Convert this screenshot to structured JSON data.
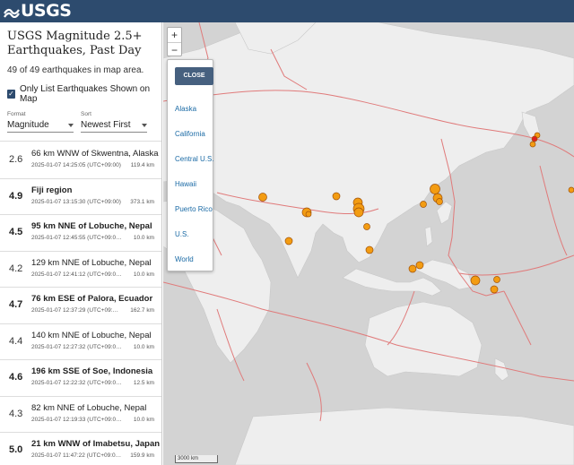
{
  "header": {
    "logo_text": "USGS",
    "bg": "#2d4b6e"
  },
  "sidebar": {
    "title": "USGS Magnitude 2.5+ Earthquakes, Past Day",
    "count_text": "49 of 49 earthquakes in map area.",
    "only_list_label": "Only List Earthquakes Shown on Map",
    "format_label": "Format",
    "format_value": "Magnitude",
    "sort_label": "Sort",
    "sort_value": "Newest First"
  },
  "earthquakes": [
    {
      "mag": "2.6",
      "place": "66 km WNW of Skwentna, Alaska",
      "time": "2025-01-07 14:25:05 (UTC+09:00)",
      "depth": "119.4 km",
      "strong": false
    },
    {
      "mag": "4.9",
      "place": "Fiji region",
      "time": "2025-01-07 13:15:30 (UTC+09:00)",
      "depth": "373.1 km",
      "strong": true
    },
    {
      "mag": "4.5",
      "place": "95 km NNE of Lobuche, Nepal",
      "time": "2025-01-07 12:45:55 (UTC+09:0…",
      "depth": "10.0 km",
      "strong": true
    },
    {
      "mag": "4.2",
      "place": "129 km NNE of Lobuche, Nepal",
      "time": "2025-01-07 12:41:12 (UTC+09:0…",
      "depth": "10.0 km",
      "strong": false
    },
    {
      "mag": "4.7",
      "place": "76 km ESE of Palora, Ecuador",
      "time": "2025-01-07 12:37:29 (UTC+09:…",
      "depth": "162.7 km",
      "strong": true
    },
    {
      "mag": "4.4",
      "place": "140 km NNE of Lobuche, Nepal",
      "time": "2025-01-07 12:27:32 (UTC+09:0…",
      "depth": "10.0 km",
      "strong": false
    },
    {
      "mag": "4.6",
      "place": "196 km SSE of Soe, Indonesia",
      "time": "2025-01-07 12:22:32 (UTC+09:0…",
      "depth": "12.5 km",
      "strong": true
    },
    {
      "mag": "4.3",
      "place": "82 km NNE of Lobuche, Nepal",
      "time": "2025-01-07 12:19:33 (UTC+09:0…",
      "depth": "10.0 km",
      "strong": false
    },
    {
      "mag": "5.0",
      "place": "21 km WNW of Imabetsu, Japan",
      "time": "2025-01-07 11:47:22 (UTC+09:0…",
      "depth": "159.9 km",
      "strong": true
    }
  ],
  "map": {
    "zoom_in": "+",
    "zoom_out": "−",
    "close_label": "CLOSE",
    "regions": [
      "Alaska",
      "California",
      "Central U.S.",
      "Hawaii",
      "Puerto Rico",
      "U.S.",
      "World"
    ],
    "scale_label": "3000 km",
    "quake_color": "#f39c12",
    "recent_color": "#e02020",
    "plate_color": "#e07a7a"
  }
}
